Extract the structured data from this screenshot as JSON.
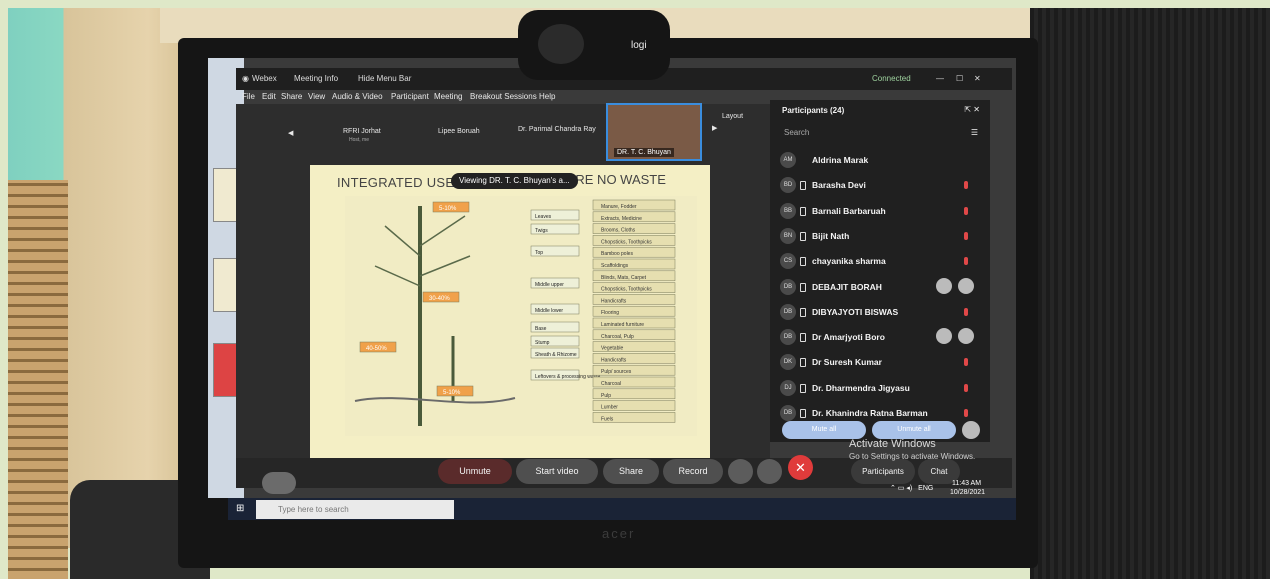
{
  "webex": {
    "app_name": "Webex",
    "meeting_info": "Meeting Info",
    "hide_menu_bar": "Hide Menu Bar",
    "connected": "Connected"
  },
  "menu": [
    "File",
    "Edit",
    "Share",
    "View",
    "Audio & Video",
    "Participant",
    "Meeting",
    "Breakout Sessions",
    "Help"
  ],
  "stage": {
    "thumbnails": [
      "RFRI Jorhat",
      "Lipee Boruah",
      "Dr. Parimal Chandra Ray"
    ],
    "thumb_sub": "Host, me",
    "video_name": "DR. T. C. Bhuyan",
    "layout_label": "Layout",
    "viewing_tooltip": "Viewing DR. T. C. Bhuyan's a...",
    "slide_title_left": "INTEGRATED USE O",
    "slide_title_right": "URE NO WASTE"
  },
  "diagram": {
    "parts": [
      "Leaves",
      "Twigs",
      "Top",
      "Middle upper",
      "Middle lower",
      "Base",
      "Stump",
      "Sheath & Rhizome",
      "Leftovers & processing waste"
    ],
    "uses": [
      "Manure, Fodder",
      "Extracts, Medicine",
      "Brooms, Cloths",
      "Chopsticks, Toothpicks",
      "Bamboo poles",
      "Scaffoldings",
      "Blinds, Mats, Carpet",
      "Chopsticks, Toothpicks",
      "Handicrafts",
      "Flooring",
      "Laminated furniture",
      "Charcoal, Pulp",
      "Vegetable",
      "Handicrafts",
      "Pulp/ sources",
      "Charcoal",
      "Pulp",
      "Lumber",
      "Fuels"
    ],
    "percent_labels": [
      "5-10%",
      "30-40%",
      "40-50%",
      "5-10%"
    ]
  },
  "participants": {
    "header": "Participants (24)",
    "search_placeholder": "Search",
    "list": [
      {
        "initials": "AM",
        "name": "Aldrina Marak"
      },
      {
        "initials": "BD",
        "name": "Barasha Devi"
      },
      {
        "initials": "BB",
        "name": "Barnali Barbaruah"
      },
      {
        "initials": "BN",
        "name": "Bijit Nath"
      },
      {
        "initials": "CS",
        "name": "chayanika sharma"
      },
      {
        "initials": "DB",
        "name": "DEBAJIT BORAH"
      },
      {
        "initials": "DB",
        "name": "DIBYAJYOTI BISWAS"
      },
      {
        "initials": "DB",
        "name": "Dr Amarjyoti Boro"
      },
      {
        "initials": "DK",
        "name": "Dr Suresh Kumar"
      },
      {
        "initials": "DJ",
        "name": "Dr. Dharmendra Jigyasu"
      },
      {
        "initials": "DB",
        "name": "Dr. Khanindra Ratna Barman"
      }
    ],
    "mute_all": "Mute all",
    "unmute_all": "Unmute all"
  },
  "controls": {
    "unmute": "Unmute",
    "start_video": "Start video",
    "share": "Share",
    "record": "Record",
    "participants": "Participants",
    "chat": "Chat"
  },
  "watermark": {
    "line1": "Activate Windows",
    "line2": "Go to Settings to activate Windows."
  },
  "taskbar": {
    "search_placeholder": "Type here to search",
    "lang": "ENG",
    "time": "11:43 AM",
    "date": "10/28/2021"
  },
  "hardware": {
    "webcam_logo": "logi",
    "monitor_brand": "acer"
  },
  "colors": {
    "end_call": "#e03b3b",
    "mic_muted": "#e04848",
    "active_video_border": "#3a8dde"
  }
}
